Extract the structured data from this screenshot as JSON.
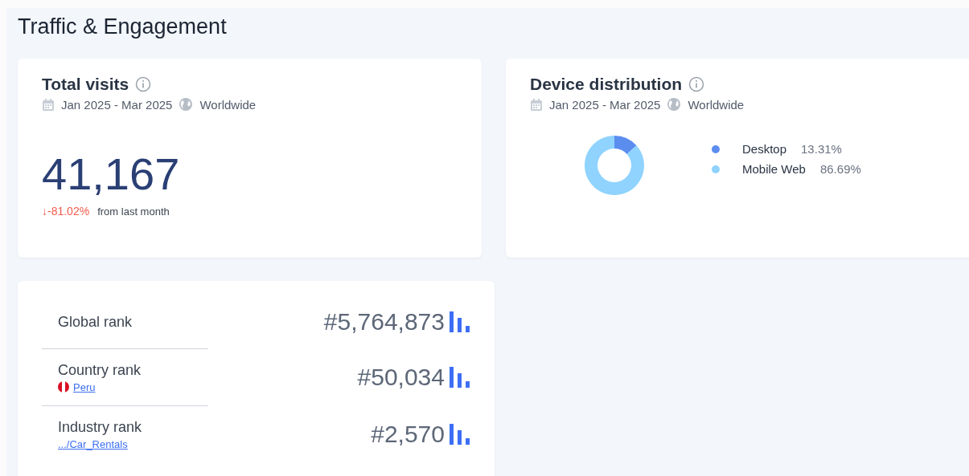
{
  "section": {
    "title": "Traffic & Engagement"
  },
  "total_visits": {
    "title": "Total visits",
    "date_range": "Jan 2025 - Mar 2025",
    "region": "Worldwide",
    "value": "41,167",
    "change": "↓-81.02%",
    "change_note": "from last month"
  },
  "device_distribution": {
    "title": "Device distribution",
    "date_range": "Jan 2025 - Mar 2025",
    "region": "Worldwide",
    "legend": [
      {
        "label": "Desktop",
        "value": "13.31%",
        "color": "#5b8def"
      },
      {
        "label": "Mobile Web",
        "value": "86.69%",
        "color": "#8fd3fe"
      }
    ],
    "chart_data": {
      "type": "donut",
      "values": [
        13.31,
        86.69
      ]
    }
  },
  "ranks": [
    {
      "label": "Global rank",
      "value": "#5,764,873"
    },
    {
      "label": "Country rank",
      "link": "Peru",
      "flag": true,
      "value": "#50,034"
    },
    {
      "label": "Industry rank",
      "link": ".../Car_Rentals",
      "value": "#2,570"
    }
  ]
}
